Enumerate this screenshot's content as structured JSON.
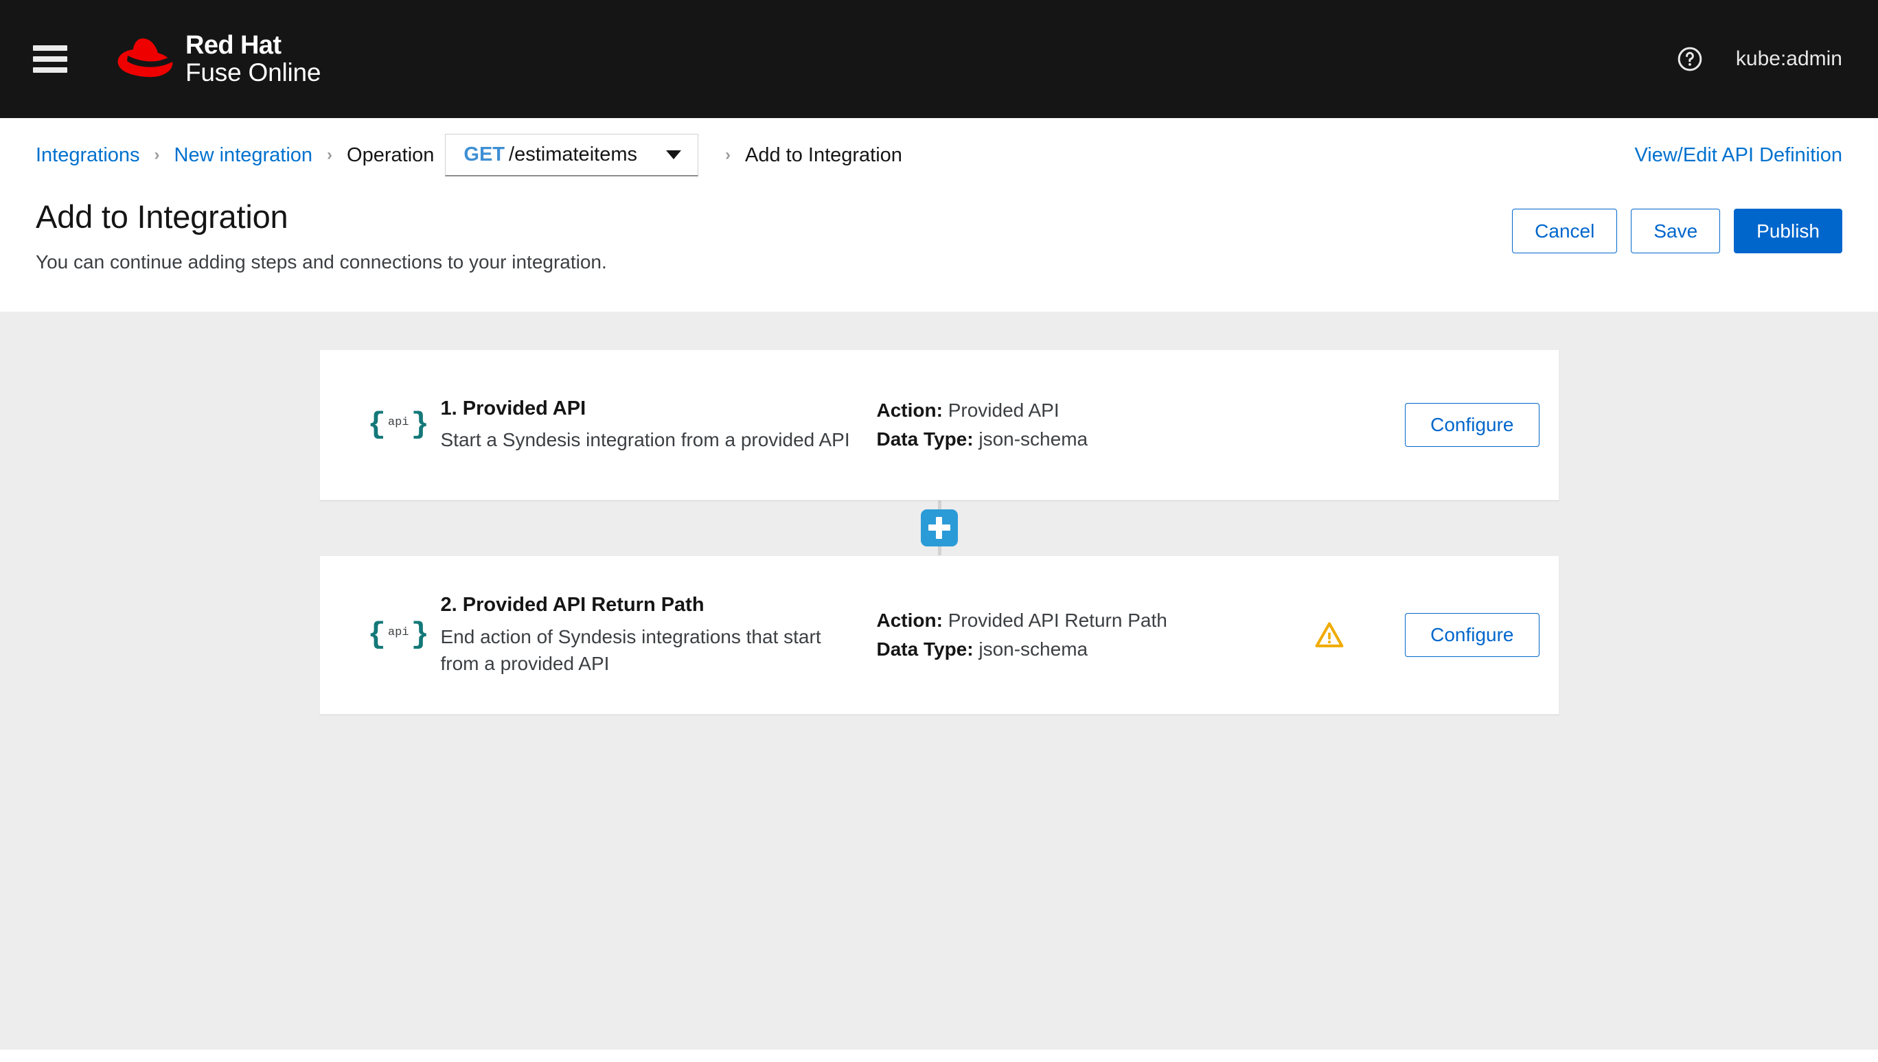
{
  "masthead": {
    "menu_icon": "hamburger-icon",
    "brand_line1": "Red Hat",
    "brand_line2": "Fuse Online",
    "help_icon": "help-circle-icon",
    "username": "kube:admin"
  },
  "breadcrumb": {
    "items": [
      {
        "label": "Integrations",
        "type": "link"
      },
      {
        "label": "New integration",
        "type": "link"
      },
      {
        "label": "Operation",
        "type": "text"
      },
      {
        "label": "Add to Integration",
        "type": "text"
      }
    ],
    "separator": "›",
    "operation_dropdown": {
      "method": "GET",
      "path": "/estimateitems",
      "caret_icon": "caret-down-icon"
    },
    "api_definition_link": "View/Edit API Definition"
  },
  "page": {
    "title": "Add to Integration",
    "subtitle": "You can continue adding steps and connections to your integration."
  },
  "toolbar": {
    "cancel_label": "Cancel",
    "save_label": "Save",
    "publish_label": "Publish"
  },
  "flow": {
    "add_step_icon": "plus-icon",
    "steps": [
      {
        "icon": "api-braces-icon",
        "icon_text": "api",
        "title": "1. Provided API",
        "description": "Start a Syndesis integration from a provided API",
        "action_label": "Action:",
        "action_value": "Provided API",
        "datatype_label": "Data Type:",
        "datatype_value": "json-schema",
        "warning": false,
        "configure_label": "Configure"
      },
      {
        "icon": "api-braces-icon",
        "icon_text": "api",
        "title": "2. Provided API Return Path",
        "description": "End action of Syndesis integrations that start from a provided API",
        "action_label": "Action:",
        "action_value": "Provided API Return Path",
        "datatype_label": "Data Type:",
        "datatype_value": "json-schema",
        "warning": true,
        "warning_icon": "warning-triangle-icon",
        "configure_label": "Configure"
      }
    ]
  },
  "colors": {
    "masthead_bg": "#151515",
    "brand_red": "#ee0000",
    "link_blue": "#0071ce",
    "primary_blue": "#0066cc",
    "add_button_blue": "#2b9bd8",
    "warning_amber": "#f0ab00",
    "api_icon_teal": "#147878",
    "canvas_gray": "#ededed"
  }
}
